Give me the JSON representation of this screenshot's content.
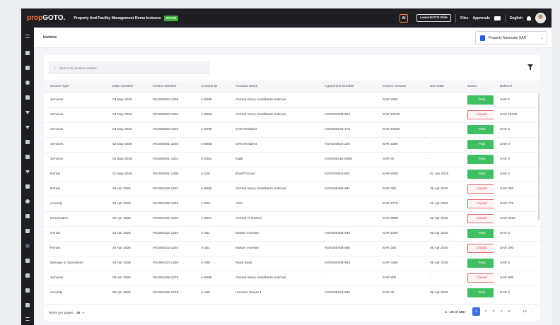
{
  "app": {
    "logo_a": "prop",
    "logo_b": "GOTO.",
    "instance": "Property And Facility Management Demo Instance",
    "stage": "STAGE",
    "ai_label": "AI",
    "elite": "LeaseGOTO Elite",
    "files": "Files",
    "approvals": "Approvals",
    "language": "English"
  },
  "header": {
    "title": "Invoice",
    "company": "Property Automate SAR"
  },
  "search": {
    "placeholder": "Search by invoice number"
  },
  "table": {
    "columns": [
      "Invoice Type",
      "Date Created",
      "Invoice Number",
      "Account ID",
      "Account Name",
      "Agreement Number",
      "Invoice Amount",
      "Due Date",
      "Status",
      "Balance"
    ],
    "rows": [
      [
        "Services",
        "03 May 2026",
        "INV260503-1305",
        "A-0088",
        "Ahmed Samy Abdelfatah Soliman",
        "-",
        "SAR 2300",
        "-",
        "Paid",
        "SAR 0"
      ],
      [
        "Services",
        "03 May 2026",
        "INV260503-1304",
        "A-0088",
        "Ahmed Samy Abdelfatah Soliman",
        "AGR251009-254",
        "SAR 16100",
        "-",
        "Unpaid",
        "SAR 16100"
      ],
      [
        "Services",
        "03 May 2026",
        "INV260503-1303",
        "A-0005",
        "SAR.Resident",
        "AGR250623-175",
        "SAR 19550",
        "-",
        "Paid",
        "SAR 0"
      ],
      [
        "Services",
        "02 May 2026",
        "INV260501-1302",
        "A-0005",
        "SAR.Resident",
        "AGR250504-126",
        "SAR 1090",
        "-",
        "Paid",
        "SAR 0"
      ],
      [
        "Services",
        "02 May 2026",
        "INV260501-1301",
        "A-0002",
        "Najib",
        "AGR250319-0088",
        "SAR 40",
        "-",
        "Paid",
        "SAR 0"
      ],
      [
        "Rental",
        "01 May 2026",
        "INV260501-1300",
        "A-128",
        "Sheriff Ismail",
        "AGR260501-502",
        "SAR 6000",
        "01 Jan 2026",
        "Paid",
        "SAR 0"
      ],
      [
        "Rental",
        "29 Apr 2026",
        "INV260429-1297",
        "A-0088",
        "Ahmed Samy Abdelfatah Soliman",
        "AGR260426-491",
        "SAR 350",
        "26 Apr 2026",
        "Unpaid",
        "SAR 250"
      ],
      [
        "Amenity",
        "28 Apr 2026",
        "INV260428-1295",
        "A-203",
        "Afrid",
        "-",
        "SAR 2775",
        "22 Apr 2026",
        "Unpaid",
        "SAR 775"
      ],
      [
        "Reservation",
        "25 Apr 2026",
        "INV260425-1294",
        "A-0001",
        "Ahmed Al Rashid",
        "-",
        "SAR 2999",
        "25 Apr 2026",
        "Unpaid",
        "SAR 2999"
      ],
      [
        "Rental",
        "23 Apr 2026",
        "INV260423-1292",
        "A-161",
        "Master Investor",
        "AGR260408-485",
        "SAR 1800",
        "08 Apr 2026",
        "Paid",
        "SAR 0"
      ],
      [
        "Rental",
        "23 Apr 2026",
        "INV260423-1291",
        "A-161",
        "Master Investor",
        "AGR260408-485",
        "SAR 300",
        "08 Apr 2026",
        "Unpaid",
        "SAR 300"
      ],
      [
        "Manage & Operations",
        "23 Apr 2026",
        "INV260423-1290",
        "A-198",
        "Ryad Bank",
        "AGR260408-484",
        "SAR 4260",
        "08 Apr 2026",
        "Paid",
        "SAR 0"
      ],
      [
        "Services",
        "08 Apr 2026",
        "INV260408-1279",
        "A-0088",
        "Ahmed Samy Abdelfatah Soliman",
        "-",
        "SAR 900",
        "-",
        "Unpaid",
        "SAR 900"
      ],
      [
        "Amenity",
        "06 Apr 2026",
        "INV260406-1275",
        "A-195",
        "Hossam Owner 1",
        "AGR260224-465",
        "SAR 40",
        "06 Apr 2026",
        "Paid",
        "SAR 0"
      ]
    ]
  },
  "footer": {
    "rows_per_page_label": "Rows per pages",
    "rows_per_page_value": "25",
    "range": "1 - 25 of 468",
    "prev": "‹",
    "pages": [
      "1",
      "2",
      "3",
      "4",
      "5",
      "...",
      "19"
    ],
    "active_page": "1",
    "next": "›"
  },
  "colors": {
    "paid": "#3fbf61",
    "unpaid": "#e0434d",
    "brand": "#ff7a3d",
    "active_page": "#3f6fd9"
  },
  "icons": {
    "filter": "filter-icon",
    "search": "search-icon",
    "notification": "bell-icon",
    "mail": "mail-icon"
  }
}
